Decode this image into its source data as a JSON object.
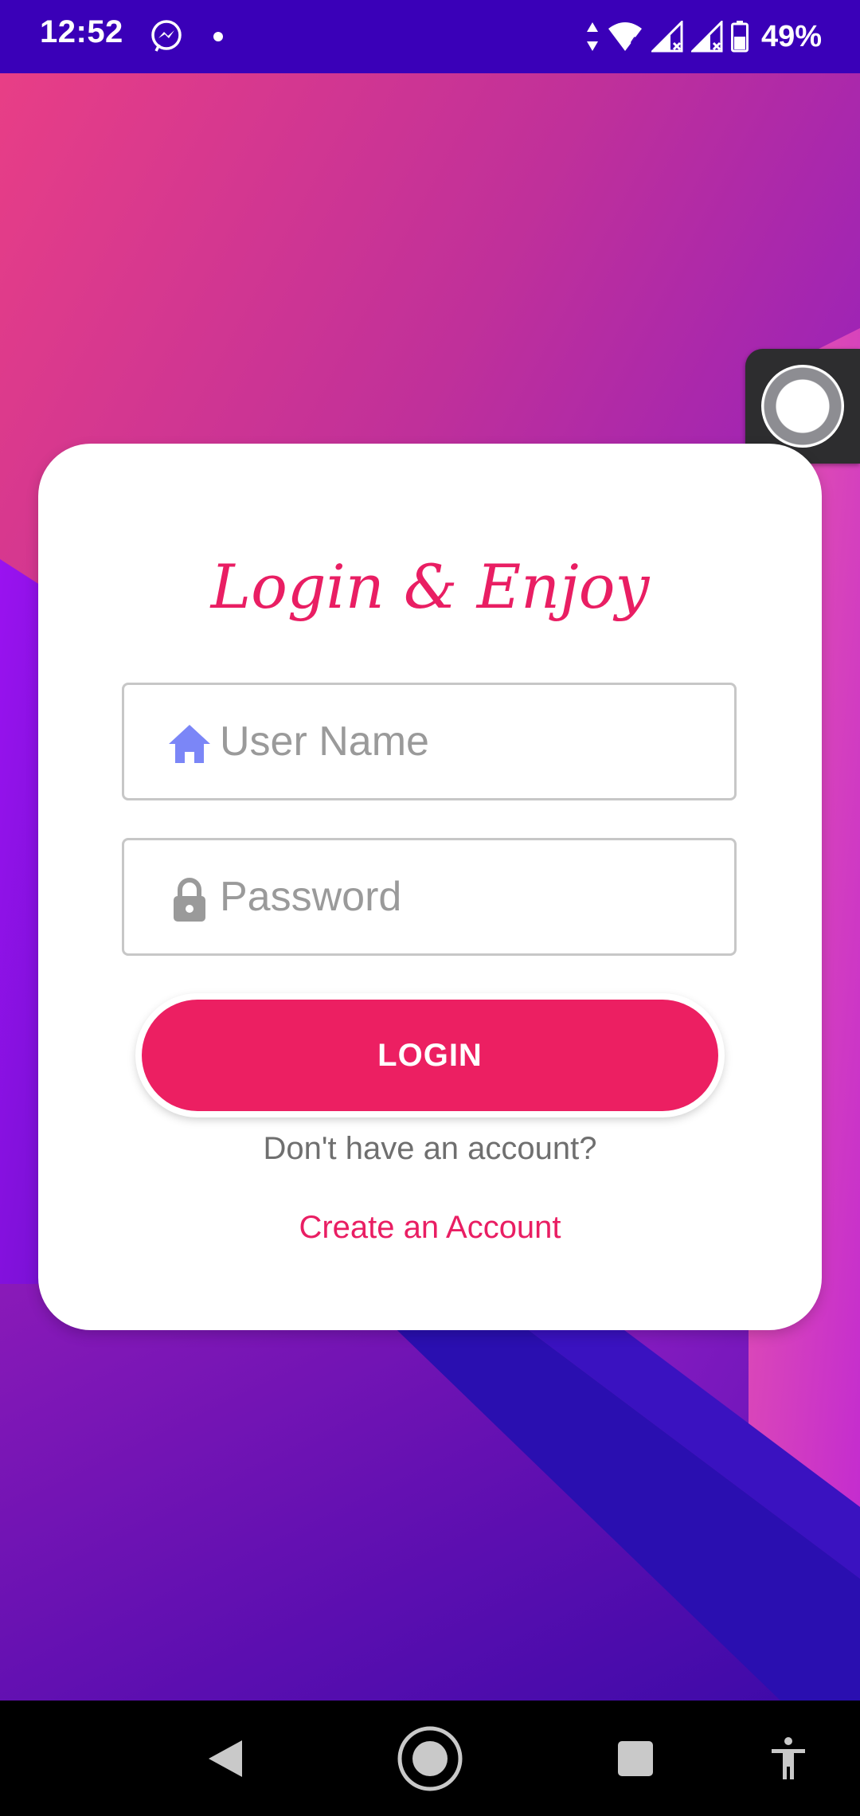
{
  "status_bar": {
    "time": "12:52",
    "battery_percent": "49%",
    "background_color": "#3a00b8",
    "icons": [
      "messenger-icon",
      "notification-dot-icon",
      "data-arrows-icon",
      "wifi-icon",
      "signal-icon",
      "signal-icon",
      "battery-icon"
    ]
  },
  "login_card": {
    "title": "Login & Enjoy",
    "username_placeholder": "User Name",
    "username_value": "",
    "password_placeholder": "Password",
    "password_value": "",
    "login_button_label": "LOGIN",
    "no_account_text": "Don't have an account?",
    "create_account_link": "Create an Account"
  },
  "colors": {
    "accent": "#e91e63",
    "login_button": "#ec1f62",
    "home_icon": "#7b86f7",
    "lock_icon": "#9a9a9a"
  },
  "navigation_bar": {
    "buttons": [
      "back-icon",
      "home-icon",
      "recents-icon",
      "accessibility-icon"
    ]
  }
}
